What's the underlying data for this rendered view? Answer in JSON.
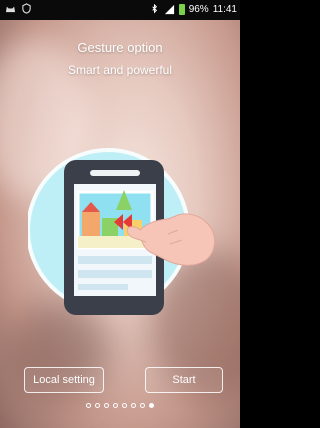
{
  "status_bar": {
    "battery_text": "96%",
    "time": "11:41",
    "icons": [
      "cat-icon",
      "shield-icon",
      "bluetooth-icon",
      "signal-icon",
      "battery-icon"
    ]
  },
  "onboarding": {
    "title": "Gesture option",
    "subtitle": "Smart and powerful",
    "buttons": {
      "local_setting": "Local setting",
      "start": "Start"
    },
    "pagination": {
      "total": 8,
      "active_index": 7
    }
  }
}
